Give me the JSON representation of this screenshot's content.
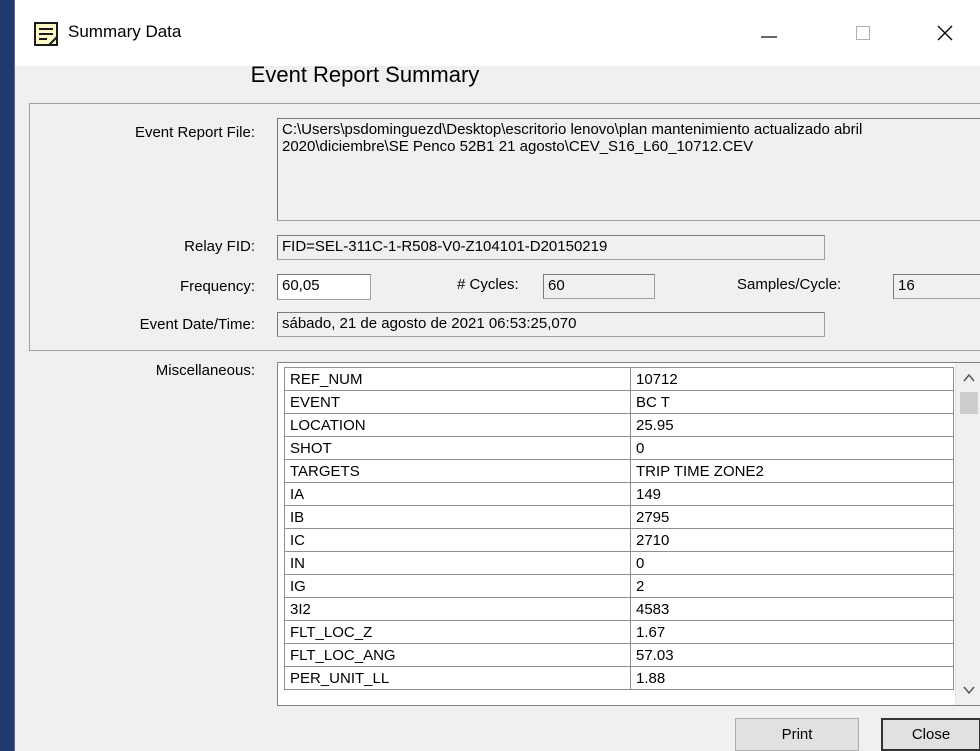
{
  "window": {
    "title": "Summary Data",
    "app_icon": "notepad-icon"
  },
  "controls": {
    "minimize": "minimize-icon",
    "maximize": "maximize-icon",
    "close": "close-icon"
  },
  "heading": "Event Report Summary",
  "event_report": {
    "label": "Event Report File:",
    "value": "C:\\Users\\psdominguezd\\Desktop\\escritorio lenovo\\plan mantenimiento actualizado abril 2020\\diciembre\\SE Penco 52B1 21 agosto\\CEV_S16_L60_10712.CEV"
  },
  "relay": {
    "label": "Relay FID:",
    "value": "FID=SEL-311C-1-R508-V0-Z104101-D20150219"
  },
  "frequency": {
    "label": "Frequency:",
    "value": "60,05"
  },
  "cycles": {
    "label": "# Cycles:",
    "value": "60"
  },
  "samples": {
    "label": "Samples/Cycle:",
    "value": "16"
  },
  "event_time": {
    "label": "Event Date/Time:",
    "value": "sábado, 21 de agosto de 2021  06:53:25,070"
  },
  "misc": {
    "label": "Miscellaneous:",
    "rows": [
      {
        "key": "REF_NUM",
        "value": "10712"
      },
      {
        "key": "EVENT",
        "value": "BC T"
      },
      {
        "key": "LOCATION",
        "value": "25.95"
      },
      {
        "key": "SHOT",
        "value": "0"
      },
      {
        "key": "TARGETS",
        "value": "TRIP TIME ZONE2"
      },
      {
        "key": "IA",
        "value": "149"
      },
      {
        "key": "IB",
        "value": "2795"
      },
      {
        "key": "IC",
        "value": "2710"
      },
      {
        "key": "IN",
        "value": "0"
      },
      {
        "key": "IG",
        "value": "2"
      },
      {
        "key": "3I2",
        "value": "4583"
      },
      {
        "key": "FLT_LOC_Z",
        "value": "1.67"
      },
      {
        "key": "FLT_LOC_ANG",
        "value": "57.03"
      },
      {
        "key": "PER_UNIT_LL",
        "value": "1.88"
      }
    ]
  },
  "buttons": {
    "print": "Print",
    "close": "Close"
  }
}
